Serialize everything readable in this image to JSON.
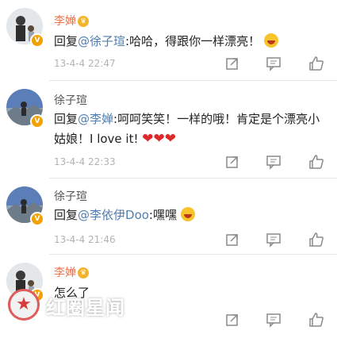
{
  "comments": [
    {
      "username": "李婵",
      "reply_prefix": "回复",
      "mention": "@徐子瑄",
      "body": ":哈哈，得跟你一样漂亮！",
      "time": "13-4-4 22:47"
    },
    {
      "username": "徐子瑄",
      "reply_prefix": "回复",
      "mention": "@李婵",
      "body": ":呵呵笑笑！一样的哦！肯定是个漂亮小姑娘！I love it!",
      "time": "13-4-4 22:33"
    },
    {
      "username": "徐子瑄",
      "reply_prefix": "回复",
      "mention": "@李依伊Doo",
      "body": ":嘿嘿",
      "time": "13-4-4 21:46"
    },
    {
      "username": "李婵",
      "body": "怎么了",
      "time": ""
    }
  ],
  "icons": {
    "forward": "share-icon",
    "comment": "comment-icon",
    "like": "thumbs-up-icon",
    "verified": "verified-badge-icon",
    "crown": "vip-crown-icon"
  },
  "colors": {
    "username_highlight": "#eb7350",
    "mention": "#507daf",
    "time": "#b3b3b3",
    "heart": "#e02828"
  },
  "watermark": {
    "text": "红圈星闻"
  }
}
